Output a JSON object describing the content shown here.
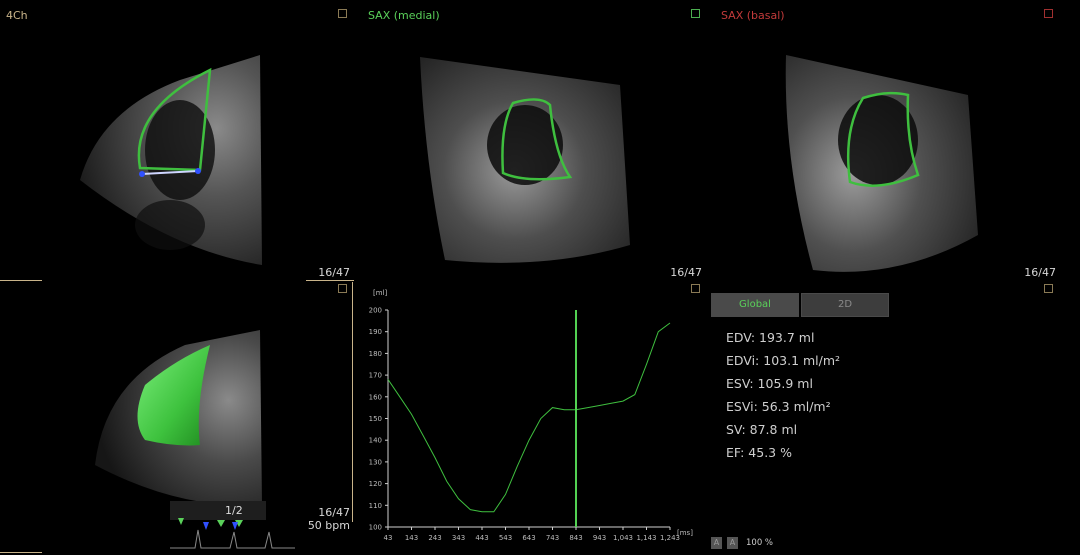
{
  "colors": {
    "four_ch": "#c9b48a",
    "medial": "#5ad15a",
    "basal": "#c23a3a",
    "contour": "#3fbf3f",
    "cursor": "#52d152",
    "accent_box": "#8a7a55"
  },
  "panes": {
    "four_ch": {
      "title": "4Ch",
      "frame": "16/47"
    },
    "medial": {
      "title": "SAX (medial)",
      "frame": "16/47"
    },
    "basal": {
      "title": "SAX (basal)",
      "frame": "16/47"
    },
    "volume": {
      "frame": "16/47",
      "heart_rate": "50 bpm",
      "cycle": "1/2"
    }
  },
  "chart_data": {
    "type": "line",
    "ylabel": "[ml]",
    "xlabel": "[ms]",
    "ylim": [
      100,
      200
    ],
    "xlim": [
      43,
      1243
    ],
    "yticks": [
      100,
      110,
      120,
      130,
      140,
      150,
      160,
      170,
      180,
      190,
      200
    ],
    "xtick_labels": [
      "43",
      "143",
      "243",
      "343",
      "443",
      "543",
      "643",
      "743",
      "843",
      "943",
      "1,043",
      "1,143",
      "1,243"
    ],
    "xtick_values": [
      43,
      143,
      243,
      343,
      443,
      543,
      643,
      743,
      843,
      943,
      1043,
      1143,
      1243
    ],
    "cursor_x": 843,
    "series": [
      {
        "x": [
          43,
          93,
          143,
          193,
          243,
          293,
          343,
          393,
          443,
          493,
          543,
          593,
          643,
          693,
          743,
          793,
          843,
          893,
          943,
          993,
          1043,
          1093,
          1143,
          1193,
          1243
        ],
        "values": [
          168,
          160,
          152,
          142,
          132,
          121,
          113,
          108,
          107,
          107,
          115,
          128,
          140,
          150,
          155,
          154,
          154,
          155,
          156,
          157,
          158,
          161,
          175,
          190,
          194
        ]
      }
    ]
  },
  "tabs": {
    "global": "Global",
    "two_d": "2D"
  },
  "metrics": [
    "EDV: 193.7 ml",
    "EDVi: 103.1 ml/m²",
    "ESV: 105.9 ml",
    "ESVi: 56.3 ml/m²",
    "SV: 87.8 ml",
    "EF: 45.3 %"
  ],
  "footer": {
    "zoom": "100 %",
    "a1": "A",
    "a2": "A"
  }
}
